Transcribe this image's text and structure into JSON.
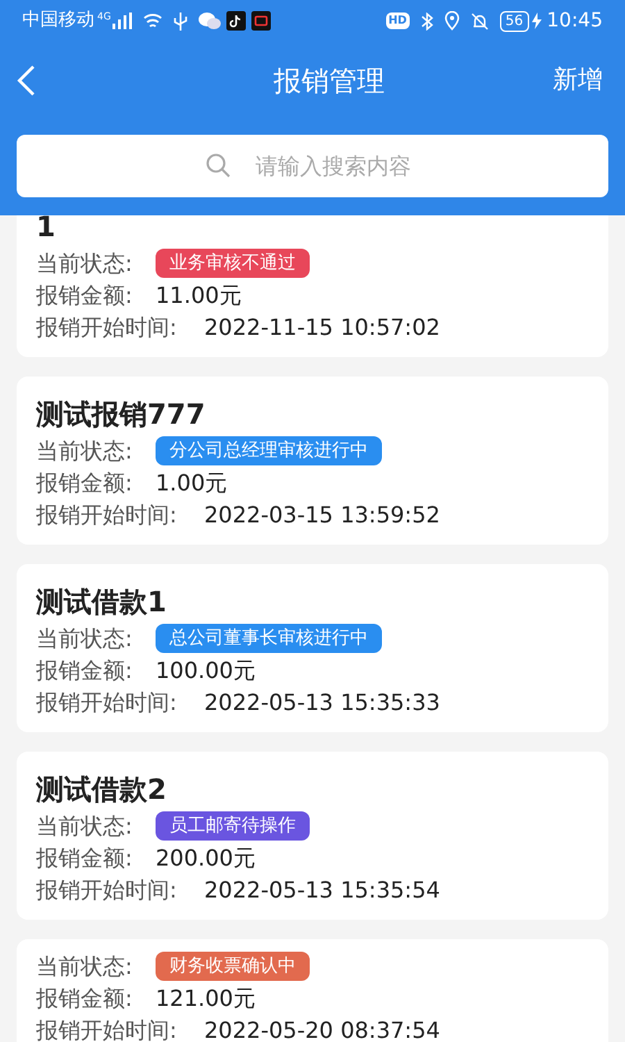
{
  "status_bar": {
    "carrier": "中国移动",
    "network": "4G",
    "hd": "HD",
    "battery": "56",
    "time": "10:45"
  },
  "header": {
    "title": "报销管理",
    "action": "新增"
  },
  "search": {
    "placeholder": "请输入搜索内容"
  },
  "records": [
    {
      "title": "1",
      "status_label": "当前状态:",
      "status": "业务审核不通过",
      "color": "#e8475a",
      "amount_label": "报销金额:",
      "amount": "11.00元",
      "time_label": "报销开始时间:",
      "time": "2022-11-15 10:57:02"
    },
    {
      "title": "测试报销777",
      "status_label": "当前状态:",
      "status": "分公司总经理审核进行中",
      "color": "#2a8ef0",
      "amount_label": "报销金额:",
      "amount": "1.00元",
      "time_label": "报销开始时间:",
      "time": "2022-03-15 13:59:52"
    },
    {
      "title": "测试借款1",
      "status_label": "当前状态:",
      "status": "总公司董事长审核进行中",
      "color": "#2a8ef0",
      "amount_label": "报销金额:",
      "amount": "100.00元",
      "time_label": "报销开始时间:",
      "time": "2022-05-13 15:35:33"
    },
    {
      "title": "测试借款2",
      "status_label": "当前状态:",
      "status": "员工邮寄待操作",
      "color": "#6a55e0",
      "amount_label": "报销金额:",
      "amount": "200.00元",
      "time_label": "报销开始时间:",
      "time": "2022-05-13 15:35:54"
    },
    {
      "status_label": "当前状态:",
      "status": "财务收票确认中",
      "color": "#e26a4e",
      "amount_label": "报销金额:",
      "amount": "121.00元",
      "time_label": "报销开始时间:",
      "time": "2022-05-20 08:37:54"
    }
  ]
}
